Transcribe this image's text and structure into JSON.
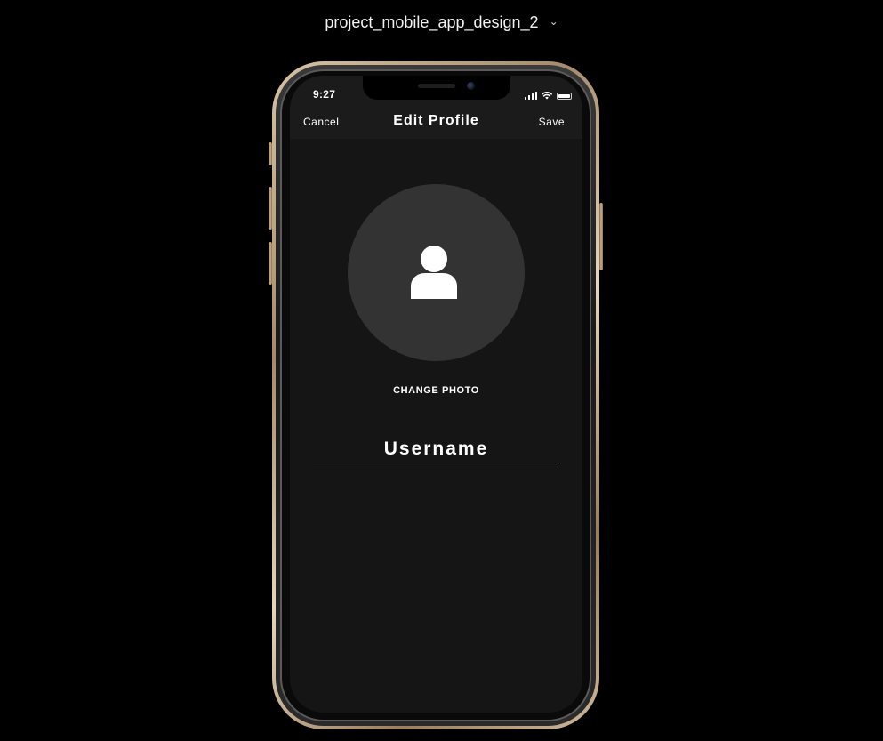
{
  "project": {
    "title": "project_mobile_app_design_2",
    "dropdown_icon": "chevron-down-icon"
  },
  "status_bar": {
    "time": "9:27",
    "icons": [
      "signal-icon",
      "wifi-icon",
      "battery-icon"
    ]
  },
  "nav": {
    "cancel_label": "Cancel",
    "title": "Edit Profile",
    "save_label": "Save"
  },
  "profile": {
    "avatar_icon": "user-icon",
    "change_photo_label": "CHANGE PHOTO",
    "username_placeholder": "Username",
    "username_value": ""
  },
  "colors": {
    "background": "#000000",
    "screen": "#151515",
    "nav_bar": "#1b1b1b",
    "avatar_circle": "#333333",
    "text": "#ffffff",
    "underline": "#9a9a9a",
    "frame_gold": "#cdb89a"
  }
}
